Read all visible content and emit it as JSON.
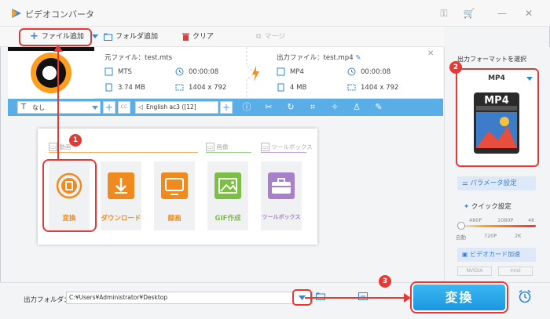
{
  "window": {
    "title": "ビデオコンバータ"
  },
  "toolbar": {
    "add_file": "ファイル追加",
    "add_folder": "フォルダ追加",
    "clear": "クリア",
    "merge": "マージ"
  },
  "file_item": {
    "source_label": "元ファイル：test.mts",
    "source_format": "MTS",
    "source_duration": "00:00:08",
    "source_size": "3.74 MB",
    "source_resolution": "1404 x 792",
    "output_label": "出力ファイル：test.mp4",
    "output_format": "MP4",
    "output_duration": "00:00:08",
    "output_size": "4 MB",
    "output_resolution": "1404 x 792"
  },
  "action_bar": {
    "subtitle_value": "なし",
    "audio_value": "English ac3 ([12]"
  },
  "tool_panel": {
    "section_video": "動画",
    "section_image": "画像",
    "section_toolbox": "ツールボックス",
    "tiles": [
      {
        "label": "変換"
      },
      {
        "label": "ダウンロード"
      },
      {
        "label": "録画"
      },
      {
        "label": "GIF作成"
      },
      {
        "label": "ツールボックス"
      }
    ]
  },
  "right_panel": {
    "format_header": "出力フォーマットを選択",
    "format_name": "MP4",
    "format_icon_text": "MP4",
    "param_button": "パラメータ設定",
    "quick_label": "クイック設定",
    "slider_top": [
      "480P",
      "1080P",
      "4K"
    ],
    "slider_bottom": [
      "自動",
      "720P",
      "2K"
    ],
    "gpu_button": "ビデオカード加速",
    "gpu_chips": [
      "NVIDIA",
      "Intel"
    ]
  },
  "bottom": {
    "output_folder_label": "出力フォルダ：",
    "output_path": "C:¥Users¥Administrator¥Desktop",
    "convert_button": "変換"
  },
  "annotations": [
    "1",
    "2",
    "3"
  ],
  "colors": {
    "accent": "#2ea4ea",
    "highlight": "#e53935",
    "orange": "#f08a1f"
  }
}
